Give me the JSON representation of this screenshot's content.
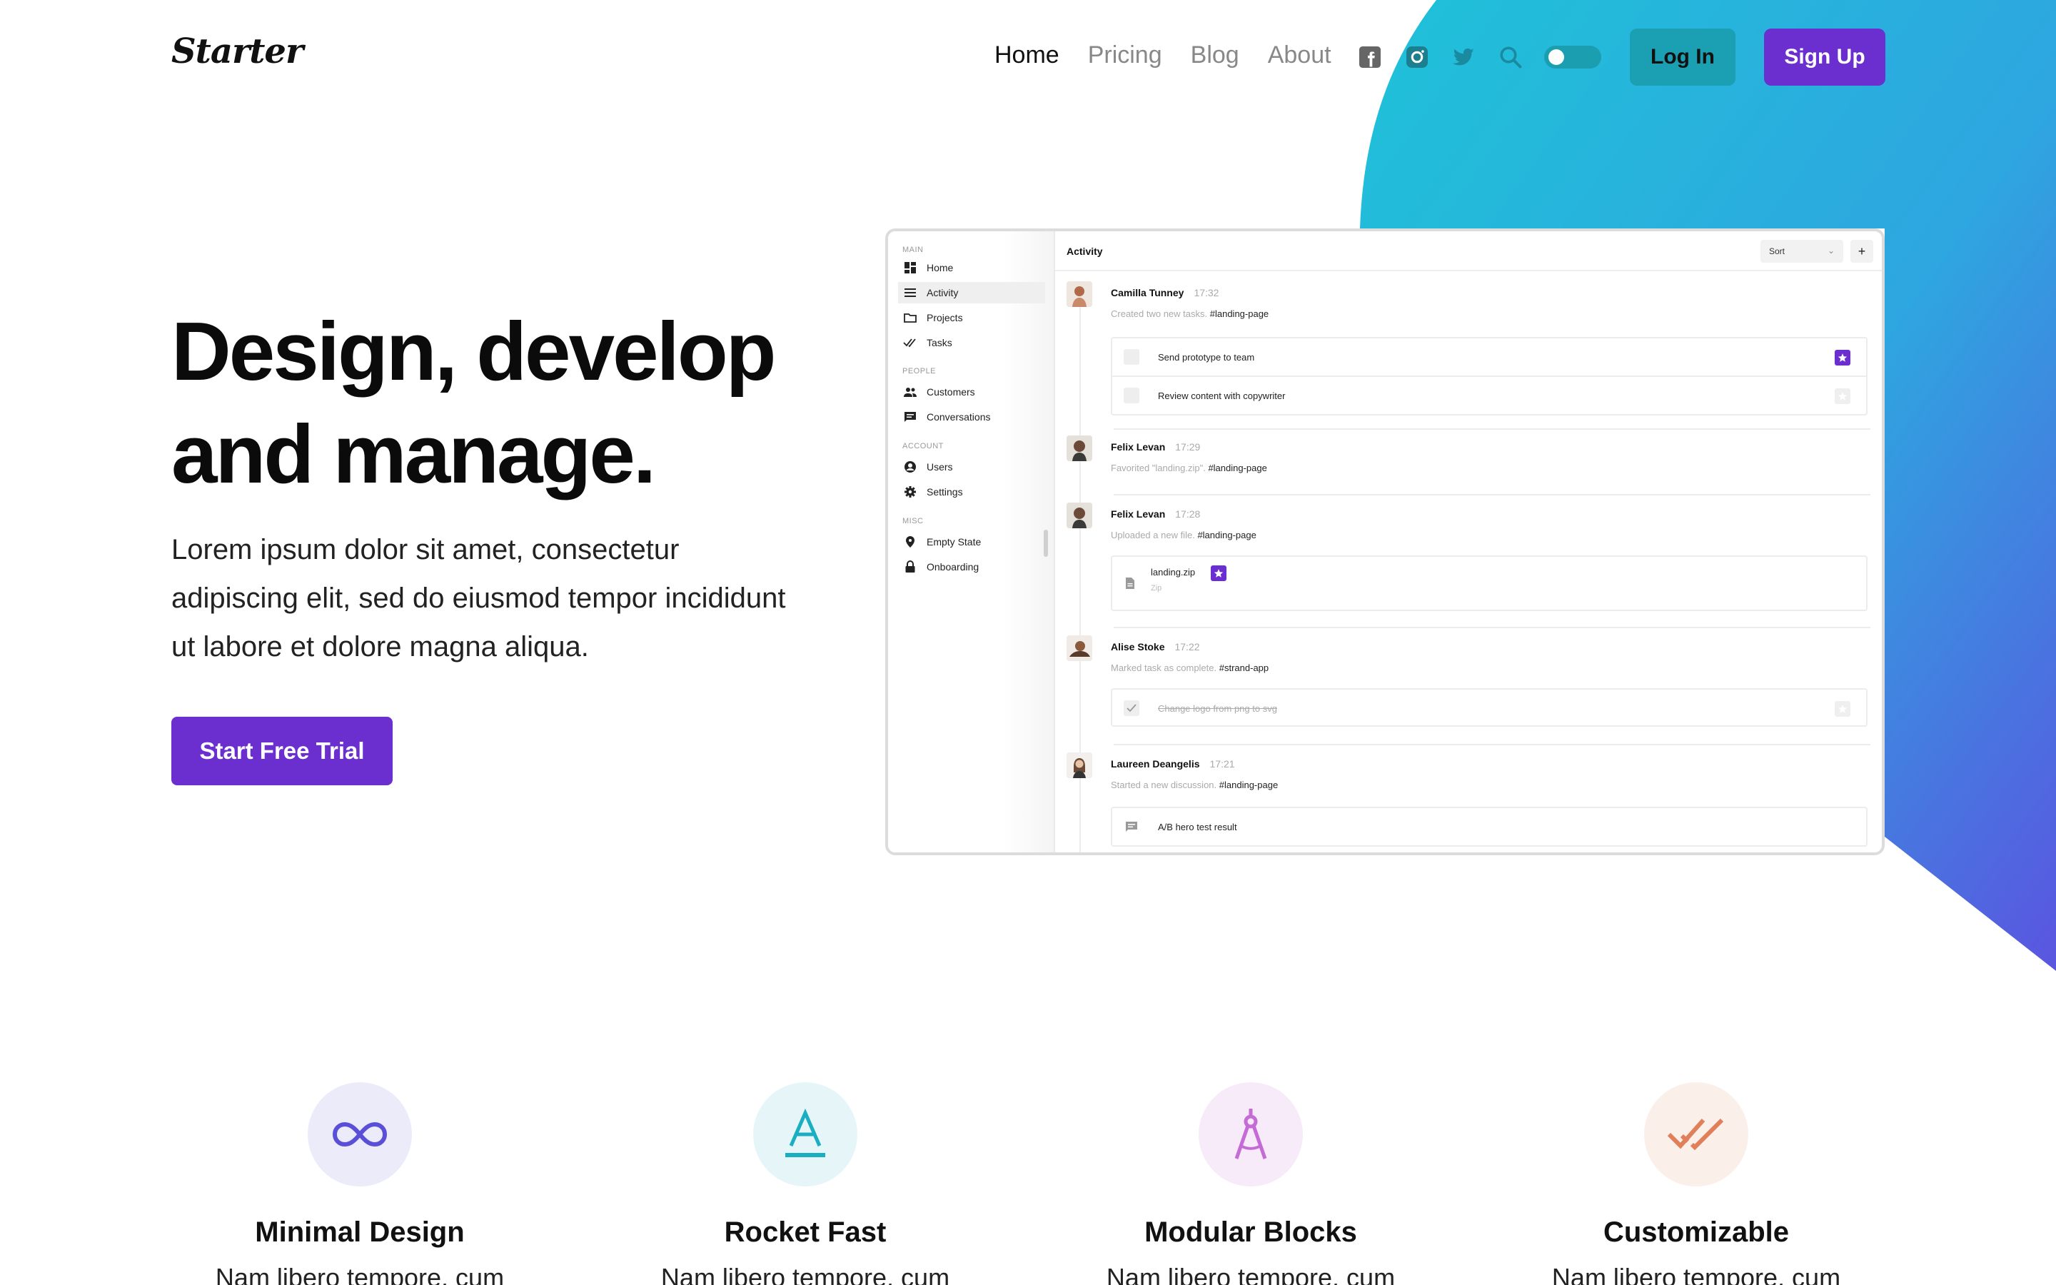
{
  "brand": {
    "logo": "Starter"
  },
  "nav": {
    "links": [
      "Home",
      "Pricing",
      "Blog",
      "About"
    ],
    "active_link": "Home",
    "icons": [
      "facebook-icon",
      "instagram-icon",
      "twitter-icon",
      "search-icon"
    ],
    "theme_toggle": "off",
    "login_label": "Log In",
    "signup_label": "Sign Up"
  },
  "colors": {
    "accent": "#6b2fd0",
    "teal": "#1a9fb3",
    "gradient_start": "#1fc2d8",
    "gradient_end": "#5a55e0"
  },
  "hero": {
    "title_line1": "Design, develop",
    "title_line2": "and manage.",
    "description": "Lorem ipsum dolor sit amet, consectetur adipiscing elit, sed do eiusmod tempor incididunt ut labore et dolore magna aliqua.",
    "cta_label": "Start Free Trial"
  },
  "app": {
    "sidebar": {
      "sections": [
        {
          "label": "MAIN",
          "items": [
            {
              "label": "Home",
              "icon": "dashboard-icon"
            },
            {
              "label": "Activity",
              "icon": "list-icon",
              "active": true
            },
            {
              "label": "Projects",
              "icon": "folder-icon"
            },
            {
              "label": "Tasks",
              "icon": "double-check-icon"
            }
          ]
        },
        {
          "label": "PEOPLE",
          "items": [
            {
              "label": "Customers",
              "icon": "people-icon"
            },
            {
              "label": "Conversations",
              "icon": "chat-icon"
            }
          ]
        },
        {
          "label": "ACCOUNT",
          "items": [
            {
              "label": "Users",
              "icon": "user-icon"
            },
            {
              "label": "Settings",
              "icon": "gear-icon"
            }
          ]
        },
        {
          "label": "MISC",
          "items": [
            {
              "label": "Empty State",
              "icon": "pin-icon"
            },
            {
              "label": "Onboarding",
              "icon": "lock-icon"
            }
          ]
        }
      ]
    },
    "header": {
      "title": "Activity",
      "sort_label": "Sort",
      "add_label": "+"
    },
    "activity": [
      {
        "name": "Camilla Tunney",
        "time": "17:32",
        "desc": "Created two new tasks.",
        "tag": "#landing-page",
        "tasks": [
          {
            "text": "Send prototype to team",
            "starred": true
          },
          {
            "text": "Review content with copywriter",
            "starred": false
          }
        ]
      },
      {
        "name": "Felix Levan",
        "time": "17:29",
        "desc": "Favorited \"landing.zip\".",
        "tag": "#landing-page"
      },
      {
        "name": "Felix Levan",
        "time": "17:28",
        "desc": "Uploaded a new file.",
        "tag": "#landing-page",
        "file": {
          "name": "landing.zip",
          "type": "Zip",
          "starred": true
        }
      },
      {
        "name": "Alise Stoke",
        "time": "17:22",
        "desc": "Marked task as complete.",
        "tag": "#strand-app",
        "tasks": [
          {
            "text": "Change logo from png to svg",
            "done": true,
            "starred": false
          }
        ]
      },
      {
        "name": "Laureen Deangelis",
        "time": "17:21",
        "desc": "Started a new discussion.",
        "tag": "#landing-page",
        "discussion": "A/B hero test result"
      }
    ]
  },
  "features": [
    {
      "title": "Minimal Design",
      "text": "Nam libero tempore, cum",
      "icon": "infinity-icon",
      "color": "#5a4fd6",
      "bg": "#ecebfa"
    },
    {
      "title": "Rocket Fast",
      "text": "Nam libero tempore, cum",
      "icon": "text-a-icon",
      "color": "#1aaec0",
      "bg": "#e6f6f8"
    },
    {
      "title": "Modular Blocks",
      "text": "Nam libero tempore, cum",
      "icon": "compass-icon",
      "color": "#c46bd6",
      "bg": "#f7ebfa"
    },
    {
      "title": "Customizable",
      "text": "Nam libero tempore, cum",
      "icon": "double-check-icon",
      "color": "#e07f5a",
      "bg": "#fbefea"
    }
  ]
}
